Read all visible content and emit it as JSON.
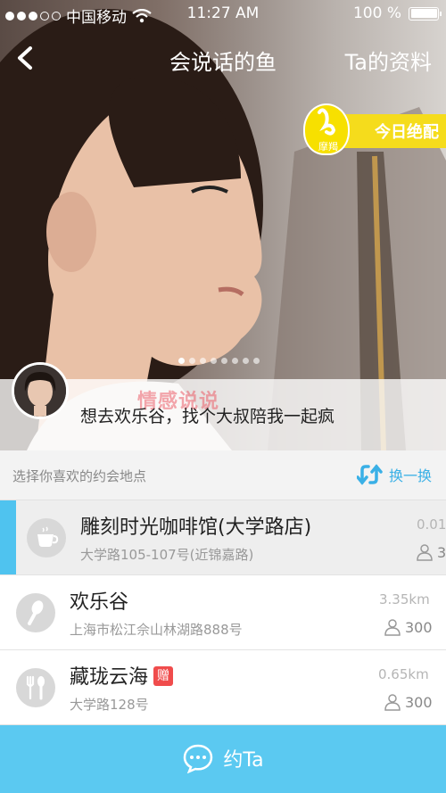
{
  "status_bar": {
    "carrier": "中国移动",
    "time": "11:27 AM",
    "battery": "100 %",
    "signal_filled": 3,
    "signal_total": 5
  },
  "nav": {
    "title": "会说话的鱼",
    "right_label": "Ta的资料"
  },
  "badge": {
    "logo_label": "摩羯",
    "text": "今日绝配"
  },
  "hero": {
    "caption": "想去欢乐谷，找个大叔陪我一起疯",
    "watermark": "情感说说",
    "pager_total": 8,
    "pager_active": 0
  },
  "section": {
    "title": "选择你喜欢的约会地点",
    "refresh_label": "换一换"
  },
  "places": [
    {
      "name": "雕刻时光咖啡馆(大学路店)",
      "address": "大学路105-107号(近锦嘉路)",
      "distance": "0.01",
      "count": "3",
      "icon": "coffee-cup-icon",
      "selected": true,
      "gift": ""
    },
    {
      "name": "欢乐谷",
      "address": "上海市松江佘山林湖路888号",
      "distance": "3.35km",
      "count": "300",
      "icon": "microphone-icon",
      "selected": false,
      "gift": ""
    },
    {
      "name": "藏珑云海",
      "address": "大学路128号",
      "distance": "0.65km",
      "count": "300",
      "icon": "fork-spoon-icon",
      "selected": false,
      "gift": "赠"
    }
  ],
  "bottom_button": {
    "label": "约Ta"
  },
  "colors": {
    "accent": "#5bc9f1",
    "badge_yellow": "#f5dc1c",
    "gift_red": "#f04c4c",
    "refresh_blue": "#3ab0e6"
  }
}
